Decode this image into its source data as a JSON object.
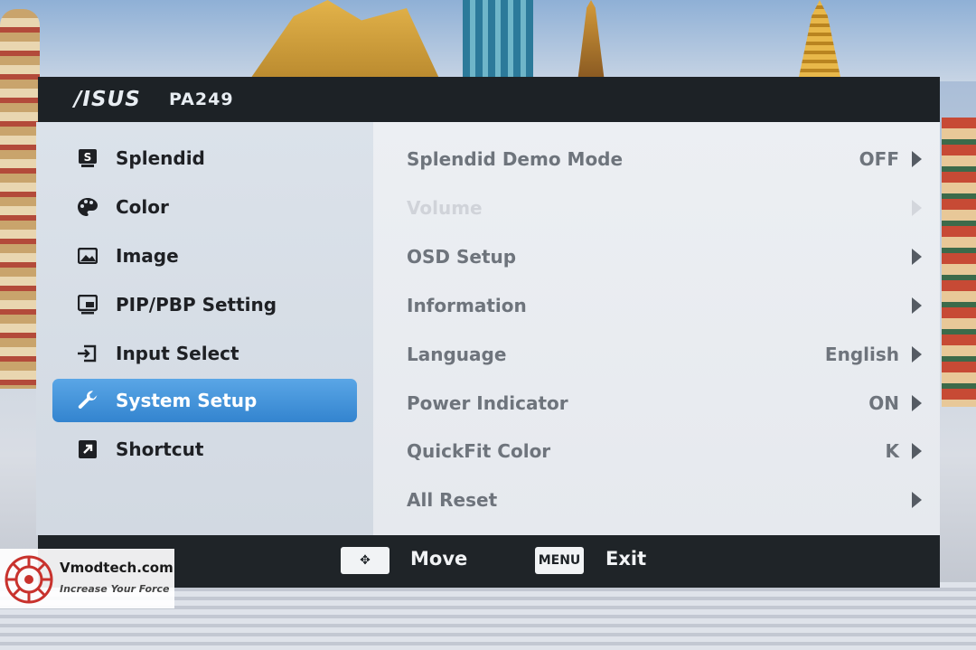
{
  "header": {
    "brand": "/ISUS",
    "model": "PA249"
  },
  "menu": [
    {
      "label": "Splendid",
      "icon": "splendid-icon",
      "selected": false
    },
    {
      "label": "Color",
      "icon": "palette-icon",
      "selected": false
    },
    {
      "label": "Image",
      "icon": "image-icon",
      "selected": false
    },
    {
      "label": "PIP/PBP Setting",
      "icon": "pip-icon",
      "selected": false
    },
    {
      "label": "Input Select",
      "icon": "input-icon",
      "selected": false
    },
    {
      "label": "System Setup",
      "icon": "wrench-icon",
      "selected": true
    },
    {
      "label": "Shortcut",
      "icon": "shortcut-icon",
      "selected": false
    }
  ],
  "settings": [
    {
      "label": "Splendid Demo Mode",
      "value": "OFF",
      "enabled": true
    },
    {
      "label": "Volume",
      "value": "",
      "enabled": false
    },
    {
      "label": "OSD Setup",
      "value": "",
      "enabled": true
    },
    {
      "label": "Information",
      "value": "",
      "enabled": true
    },
    {
      "label": "Language",
      "value": "English",
      "enabled": true
    },
    {
      "label": "Power Indicator",
      "value": "ON",
      "enabled": true
    },
    {
      "label": "QuickFit Color",
      "value": "K",
      "enabled": true
    },
    {
      "label": "All Reset",
      "value": "",
      "enabled": true
    }
  ],
  "footer": {
    "move_key": "✥",
    "move_label": "Move",
    "exit_key": "MENU",
    "exit_label": "Exit"
  },
  "watermark": {
    "site": "Vmodtech.com",
    "tagline": "Increase Your Force"
  },
  "colors": {
    "selected": "#3f8fd6",
    "header": "#1d2226",
    "text_dark": "#1e2024",
    "text_gray": "#6e747c"
  }
}
